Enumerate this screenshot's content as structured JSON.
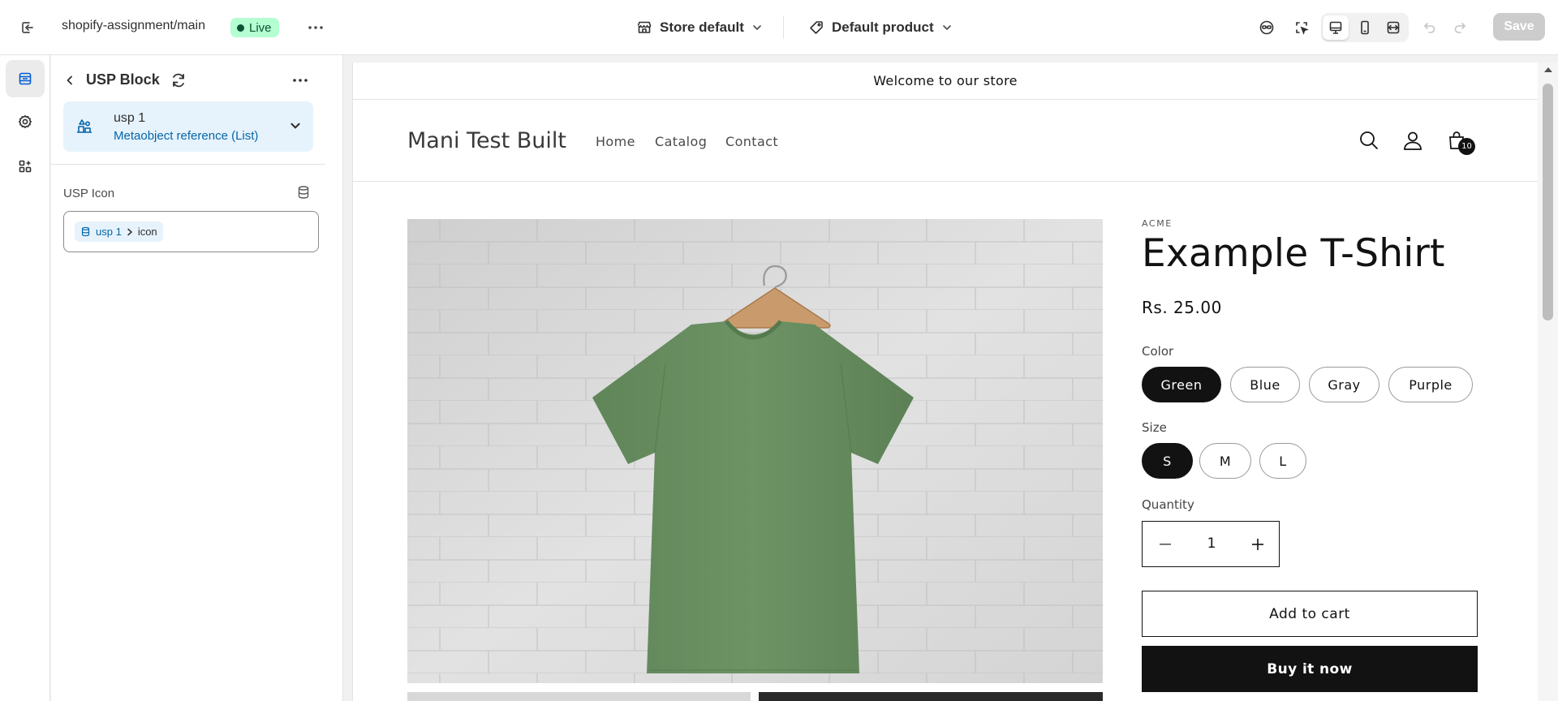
{
  "topbar": {
    "theme_name": "shopify-assignment/main",
    "status": "Live",
    "template": "Store default",
    "product": "Default product",
    "save_label": "Save"
  },
  "sidebar": {
    "title": "USP Block",
    "reference": {
      "name": "usp 1",
      "type": "Metaobject reference (List)"
    },
    "field": {
      "label": "USP Icon",
      "source": "usp 1",
      "key": "icon"
    }
  },
  "preview": {
    "announcement": "Welcome to our store",
    "store_name": "Mani Test Built",
    "nav": [
      "Home",
      "Catalog",
      "Contact"
    ],
    "cart_count": "10",
    "product": {
      "vendor": "ACME",
      "title": "Example T-Shirt",
      "price": "Rs. 25.00",
      "color_label": "Color",
      "colors": [
        "Green",
        "Blue",
        "Gray",
        "Purple"
      ],
      "selected_color": "Green",
      "size_label": "Size",
      "sizes": [
        "S",
        "M",
        "L"
      ],
      "selected_size": "S",
      "quantity_label": "Quantity",
      "quantity": "1",
      "add_to_cart": "Add to cart",
      "buy_now": "Buy it now",
      "shirt_color": "#6a8f62"
    }
  },
  "colors": {
    "accent": "#005bd3",
    "live_bg": "#b4fed2",
    "live_text": "#0c5132",
    "reference_bg": "#e6f3fc",
    "button_dark": "#121212"
  }
}
